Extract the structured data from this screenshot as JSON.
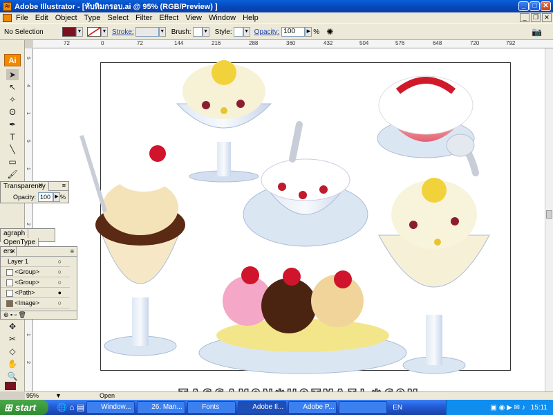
{
  "window": {
    "title": "Adobe Illustrator - [ทับทิมกรอบ.ai @ 95% (RGB/Preview) ]"
  },
  "menu": [
    "File",
    "Edit",
    "Object",
    "Type",
    "Select",
    "Filter",
    "Effect",
    "View",
    "Window",
    "Help"
  ],
  "control": {
    "selection": "No Selection",
    "stroke_label": "Stroke:",
    "brush_label": "Brush:",
    "style_label": "Style:",
    "opacity_label": "Opacity:",
    "opacity_value": "100",
    "percent": "%"
  },
  "ruler_h": [
    "72",
    "0",
    "72",
    "144",
    "216",
    "288",
    "360",
    "432",
    "504",
    "576",
    "648",
    "720",
    "792"
  ],
  "ruler_v": [
    "5",
    "4",
    "1",
    "5",
    "1",
    "1",
    "2",
    "1",
    "5",
    "2",
    "1",
    "2"
  ],
  "tools": {
    "badge": "Ai"
  },
  "transparency": {
    "tab": "Transparency",
    "opacity_label": "Opacity:",
    "opacity_value": "100",
    "percent": "%"
  },
  "char_panel": {
    "tabs": [
      "agraph",
      "OpenType"
    ]
  },
  "layers": {
    "tab": "ers",
    "rows": [
      {
        "name": "Layer 1"
      },
      {
        "name": "<Group>"
      },
      {
        "name": "<Group>"
      },
      {
        "name": "<Path>"
      },
      {
        "name": "<Image>"
      }
    ]
  },
  "status": {
    "zoom": "95%",
    "state": "Open"
  },
  "watermark": "TASSAMON*HOTMAIL*COM",
  "taskbar": {
    "start": "start",
    "tasks": [
      "Window...",
      "26. Man...",
      "Fonts",
      "Adobe Il...",
      "Adobe P...",
      ""
    ],
    "lang": "EN",
    "clock": "15:11"
  },
  "colors": {
    "fill": "#7b1020",
    "accent": "#f28a00",
    "titlebar": "#0a5fd8"
  }
}
